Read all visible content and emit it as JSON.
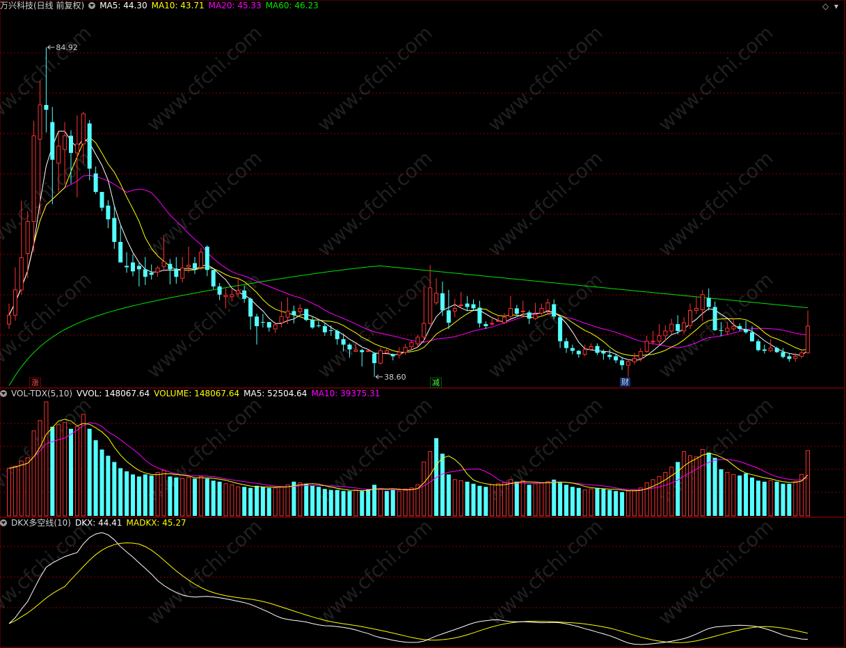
{
  "main_panel": {
    "stock_title": "万兴科技(日线 前复权)",
    "ma5_label": "MA5: 44.30",
    "ma10_label": "MA10: 43.71",
    "ma20_label": "MA20: 45.33",
    "ma60_label": "MA60: 46.23",
    "high_label": "84.92",
    "low_label": "38.60",
    "event_tags": [
      "涨",
      "减",
      "财"
    ]
  },
  "volume_panel": {
    "indicator_name": "VOL-TDX(5,10)",
    "vvol_label": "VVOL: 148067.64",
    "volume_label": "VOLUME: 148067.64",
    "ma5_label": "MA5: 52504.64",
    "ma10_label": "MA10: 39375.31"
  },
  "dkx_panel": {
    "indicator_name": "DKX多空线(10)",
    "dkx_label": "DKX: 44.41",
    "madkx_label": "MADKX: 45.27"
  },
  "watermark": "www.cfchi.com",
  "colors": {
    "up": "#ff3232",
    "down": "#54ffff",
    "ma5": "#ffffff",
    "ma10": "#ffff00",
    "ma20": "#ff00ff",
    "ma60": "#00e600",
    "grid": "#8c0000",
    "dkx": "#ffffff",
    "madkx": "#ffff00"
  },
  "chart_data": [
    {
      "type": "candlestick",
      "title": "万兴科技(日线 前复权)",
      "series_names": [
        "MA5",
        "MA10",
        "MA20",
        "MA60"
      ],
      "ylim": [
        37,
        90
      ],
      "annotations": [
        {
          "text": "84.92",
          "kind": "period-high",
          "value": 84.92
        },
        {
          "text": "38.60",
          "kind": "period-low",
          "value": 38.6
        }
      ],
      "ohlc": [
        [
          44.5,
          45.8,
          47.5,
          43.8
        ],
        [
          45.8,
          49.5,
          52.8,
          45.0
        ],
        [
          49.5,
          54.2,
          62.5,
          48.8
        ],
        [
          54.8,
          59.5,
          61.0,
          51.2
        ],
        [
          59.5,
          72.0,
          74.2,
          55.0
        ],
        [
          71.5,
          76.5,
          80.0,
          60.5
        ],
        [
          76.5,
          75.8,
          84.92,
          72.5
        ],
        [
          74.0,
          68.5,
          76.2,
          62.0
        ],
        [
          68.0,
          70.5,
          72.5,
          63.8
        ],
        [
          70.0,
          72.0,
          74.0,
          65.0
        ],
        [
          72.0,
          69.5,
          72.8,
          65.0
        ],
        [
          69.5,
          70.8,
          75.0,
          63.0
        ],
        [
          70.8,
          75.2,
          75.5,
          68.0
        ],
        [
          73.8,
          67.2,
          74.3,
          65.5
        ],
        [
          66.5,
          63.8,
          67.5,
          63.5
        ],
        [
          63.8,
          61.5,
          63.5,
          61.0
        ],
        [
          61.8,
          59.8,
          62.6,
          58.5
        ],
        [
          60.0,
          56.5,
          61.8,
          55.5
        ],
        [
          56.5,
          53.5,
          58.8,
          53.5
        ],
        [
          53.0,
          52.8,
          55.0,
          52.0
        ],
        [
          53.5,
          52.2,
          54.7,
          51.5
        ],
        [
          53.0,
          52.5,
          53.5,
          50.0
        ],
        [
          52.5,
          51.4,
          54.3,
          50.2
        ],
        [
          52.0,
          51.7,
          53.2,
          51.0
        ],
        [
          52.1,
          52.7,
          53.0,
          51.4
        ],
        [
          52.9,
          53.6,
          57.5,
          52.2
        ],
        [
          53.3,
          52.5,
          54.0,
          50.3
        ],
        [
          52.6,
          51.4,
          54.3,
          50.4
        ],
        [
          51.2,
          52.7,
          54.3,
          50.6
        ],
        [
          52.9,
          53.1,
          55.8,
          52.0
        ],
        [
          53.4,
          52.6,
          54.3,
          51.8
        ],
        [
          52.8,
          55.0,
          55.6,
          52.4
        ],
        [
          55.8,
          52.4,
          56.0,
          51.5
        ],
        [
          52.4,
          50.0,
          52.4,
          49.6
        ],
        [
          50.0,
          48.8,
          50.5,
          48.0
        ],
        [
          48.5,
          48.7,
          49.7,
          46.8
        ],
        [
          48.5,
          48.8,
          49.7,
          47.8
        ],
        [
          49.0,
          49.4,
          51.3,
          48.5
        ],
        [
          49.4,
          48.2,
          50.1,
          47.6
        ],
        [
          48.2,
          45.6,
          48.4,
          43.7
        ],
        [
          45.6,
          44.2,
          46.0,
          41.5
        ],
        [
          44.8,
          44.7,
          46.0,
          44.0
        ],
        [
          44.8,
          44.0,
          44.3,
          43.4
        ],
        [
          43.8,
          44.4,
          44.8,
          43.2
        ],
        [
          44.7,
          45.6,
          47.8,
          44.0
        ],
        [
          45.5,
          46.4,
          48.4,
          44.5
        ],
        [
          46.4,
          45.8,
          47.2,
          44.6
        ],
        [
          46.3,
          46.8,
          47.4,
          45.9
        ],
        [
          46.7,
          45.1,
          46.1,
          44.9
        ],
        [
          45.1,
          44.0,
          45.5,
          43.8
        ],
        [
          44.3,
          44.2,
          45.0,
          44.0
        ],
        [
          44.2,
          43.3,
          44.7,
          42.8
        ],
        [
          43.6,
          43.5,
          44.3,
          42.8
        ],
        [
          43.5,
          42.3,
          43.7,
          41.5
        ],
        [
          42.3,
          41.5,
          43.1,
          40.5
        ],
        [
          41.5,
          40.8,
          41.7,
          39.6
        ],
        [
          40.5,
          40.7,
          41.7,
          40.4
        ],
        [
          40.7,
          40.4,
          40.9,
          38.3
        ],
        [
          40.6,
          40.6,
          40.7,
          40.5
        ],
        [
          40.2,
          38.8,
          40.4,
          36.8
        ],
        [
          38.8,
          40.6,
          41.1,
          38.6
        ],
        [
          40.3,
          40.6,
          40.9,
          40.0
        ],
        [
          40.1,
          39.8,
          40.2,
          39.2
        ],
        [
          40.0,
          40.4,
          41.1,
          39.5
        ],
        [
          40.4,
          41.1,
          41.6,
          40.0
        ],
        [
          41.2,
          41.8,
          42.2,
          40.8
        ],
        [
          41.6,
          42.6,
          42.9,
          41.2
        ],
        [
          42.6,
          44.6,
          50.0,
          41.8
        ],
        [
          44.6,
          49.8,
          53.1,
          44.3
        ],
        [
          47.6,
          49.0,
          51.2,
          47.3
        ],
        [
          49.0,
          46.5,
          50.7,
          45.7
        ],
        [
          46.5,
          44.7,
          49.5,
          43.8
        ],
        [
          46.4,
          46.8,
          48.2,
          45.5
        ],
        [
          47.2,
          47.3,
          49.2,
          46.8
        ],
        [
          47.5,
          47.0,
          48.6,
          46.4
        ],
        [
          47.4,
          46.8,
          48.1,
          46.4
        ],
        [
          46.9,
          44.6,
          47.9,
          44.0
        ],
        [
          44.5,
          44.2,
          44.9,
          43.8
        ],
        [
          44.5,
          44.6,
          45.5,
          44.3
        ],
        [
          44.9,
          45.0,
          45.6,
          44.8
        ],
        [
          44.7,
          45.5,
          46.1,
          44.5
        ],
        [
          45.6,
          46.8,
          48.6,
          45.3
        ],
        [
          46.8,
          46.0,
          47.3,
          45.8
        ],
        [
          46.3,
          46.4,
          47.9,
          45.5
        ],
        [
          46.2,
          45.3,
          46.5,
          44.5
        ],
        [
          45.3,
          45.9,
          47.6,
          45.1
        ],
        [
          46.1,
          46.8,
          47.5,
          45.8
        ],
        [
          46.5,
          47.6,
          48.2,
          45.9
        ],
        [
          47.4,
          45.6,
          48.1,
          45.2
        ],
        [
          45.5,
          42.0,
          45.8,
          41.0
        ],
        [
          42.0,
          41.0,
          42.5,
          40.3
        ],
        [
          41.0,
          40.6,
          41.5,
          40.1
        ],
        [
          40.6,
          40.1,
          40.7,
          39.6
        ],
        [
          40.1,
          40.8,
          41.5,
          39.8
        ],
        [
          40.8,
          41.2,
          41.7,
          40.8
        ],
        [
          41.3,
          40.3,
          41.7,
          40.0
        ],
        [
          40.5,
          40.2,
          40.8,
          39.3
        ],
        [
          40.0,
          39.7,
          40.8,
          39.3
        ],
        [
          39.8,
          39.2,
          40.2,
          38.8
        ],
        [
          39.2,
          38.5,
          39.7,
          37.8
        ],
        [
          38.5,
          39.0,
          39.4,
          36.8
        ],
        [
          39.0,
          39.5,
          40.3,
          38.6
        ],
        [
          39.5,
          40.5,
          41.0,
          39.0
        ],
        [
          40.5,
          42.0,
          42.8,
          40.3
        ],
        [
          42.0,
          42.0,
          43.5,
          41.5
        ],
        [
          42.0,
          42.8,
          44.5,
          41.3
        ],
        [
          42.8,
          43.5,
          44.3,
          42.0
        ],
        [
          43.5,
          44.5,
          45.3,
          43.0
        ],
        [
          44.5,
          43.5,
          45.8,
          43.0
        ],
        [
          43.5,
          44.7,
          45.5,
          43.0
        ],
        [
          44.3,
          46.5,
          47.5,
          43.8
        ],
        [
          46.5,
          46.8,
          48.5,
          46.0
        ],
        [
          46.6,
          48.8,
          49.5,
          44.9
        ],
        [
          48.3,
          47.0,
          49.7,
          46.5
        ],
        [
          47.0,
          43.6,
          47.8,
          43.5
        ],
        [
          43.6,
          43.5,
          44.8,
          42.7
        ],
        [
          43.4,
          43.9,
          44.8,
          42.9
        ],
        [
          43.8,
          44.2,
          45.4,
          43.5
        ],
        [
          44.2,
          43.8,
          44.6,
          43.5
        ],
        [
          43.7,
          43.3,
          45.0,
          43.1
        ],
        [
          43.3,
          42.0,
          44.2,
          41.9
        ],
        [
          42.0,
          40.7,
          42.3,
          40.5
        ],
        [
          40.8,
          40.6,
          41.5,
          40.2
        ],
        [
          40.6,
          41.0,
          42.3,
          40.4
        ],
        [
          41.0,
          40.4,
          41.2,
          40.3
        ],
        [
          40.4,
          39.7,
          41.0,
          39.5
        ],
        [
          39.8,
          39.4,
          40.2,
          39.0
        ],
        [
          39.5,
          39.8,
          40.3,
          39.0
        ],
        [
          39.8,
          40.3,
          40.8,
          39.5
        ],
        [
          40.3,
          44.2,
          46.5,
          40.2
        ]
      ],
      "volume": [
        46000,
        48000,
        53000,
        56000,
        82000,
        92000,
        110000,
        86000,
        88000,
        90000,
        84000,
        86000,
        98000,
        84000,
        73000,
        64000,
        58000,
        52000,
        46000,
        43000,
        40000,
        38000,
        40000,
        39000,
        42000,
        44000,
        38000,
        37000,
        36000,
        37000,
        36000,
        38000,
        36000,
        34000,
        33000,
        31000,
        30000,
        28000,
        28000,
        27000,
        29000,
        28000,
        27000,
        27000,
        28000,
        30000,
        33000,
        32000,
        31000,
        29000,
        28000,
        26000,
        25000,
        25000,
        24000,
        24000,
        25000,
        24000,
        26000,
        30000,
        26000,
        24000,
        25000,
        24000,
        26000,
        27000,
        30000,
        52000,
        62000,
        75000,
        60000,
        40000,
        35000,
        34000,
        33000,
        31000,
        29000,
        28000,
        30000,
        31000,
        32000,
        35000,
        33000,
        34000,
        30000,
        31000,
        32000,
        33000,
        35000,
        32000,
        30000,
        28000,
        27000,
        25000,
        26000,
        27000,
        26000,
        25000,
        24000,
        23000,
        24000,
        25000,
        27000,
        32000,
        35000,
        38000,
        42000,
        47000,
        52000,
        62000,
        58000,
        57000,
        64000,
        61000,
        56000,
        45000,
        42000,
        40000,
        39000,
        41000,
        37000,
        34000,
        33000,
        34000,
        33000,
        31000,
        31000,
        33000,
        40000,
        63000
      ],
      "volume_up": [
        true,
        true,
        true,
        true,
        true,
        true,
        true,
        false,
        true,
        true,
        false,
        true,
        true,
        false,
        false,
        false,
        false,
        false,
        false,
        false,
        false,
        false,
        false,
        false,
        true,
        true,
        false,
        false,
        true,
        true,
        false,
        true,
        false,
        false,
        false,
        true,
        true,
        true,
        false,
        false,
        false,
        false,
        false,
        true,
        true,
        true,
        false,
        true,
        false,
        false,
        false,
        false,
        false,
        false,
        false,
        false,
        true,
        false,
        false,
        false,
        true,
        false,
        false,
        true,
        true,
        true,
        true,
        true,
        true,
        false,
        false,
        false,
        true,
        true,
        false,
        false,
        false,
        false,
        true,
        true,
        true,
        true,
        false,
        true,
        false,
        true,
        true,
        true,
        false,
        false,
        false,
        false,
        false,
        true,
        true,
        false,
        false,
        false,
        false,
        false,
        true,
        true,
        true,
        true,
        true,
        true,
        true,
        true,
        false,
        true,
        true,
        true,
        true,
        false,
        false,
        false,
        true,
        true,
        false,
        false,
        false,
        false,
        false,
        true,
        false,
        false,
        false,
        true,
        true,
        true
      ]
    }
  ]
}
